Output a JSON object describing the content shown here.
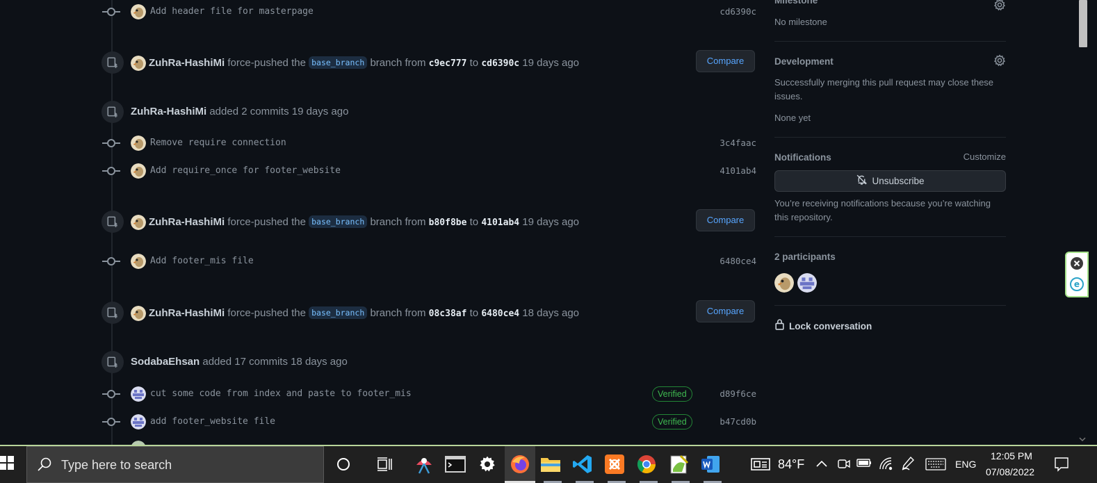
{
  "timeline": {
    "items": [
      {
        "kind": "commit",
        "message": "Add header file for masterpage",
        "sha": "cd6390c",
        "verified": false,
        "avatar": "bird"
      },
      {
        "kind": "force_push",
        "user": "ZuhRa-HashiMi",
        "action": "force-pushed the",
        "branch": "base_branch",
        "mid": "branch from",
        "from_sha": "c9ec777",
        "to": "to",
        "to_sha": "cd6390c",
        "time": "19 days ago",
        "compare": "Compare"
      },
      {
        "kind": "added",
        "user": "ZuhRa-HashiMi",
        "text": "added 2 commits 19 days ago"
      },
      {
        "kind": "commit",
        "message": "Remove require connection",
        "sha": "3c4faac",
        "avatar": "bird"
      },
      {
        "kind": "commit",
        "message": "Add require_once for footer_website",
        "sha": "4101ab4",
        "avatar": "bird"
      },
      {
        "kind": "force_push",
        "user": "ZuhRa-HashiMi",
        "action": "force-pushed the",
        "branch": "base_branch",
        "mid": "branch from",
        "from_sha": "b80f8be",
        "to": "to",
        "to_sha": "4101ab4",
        "time": "19 days ago",
        "compare": "Compare"
      },
      {
        "kind": "commit",
        "message": "Add footer_mis file",
        "sha": "6480ce4",
        "avatar": "bird"
      },
      {
        "kind": "force_push",
        "user": "ZuhRa-HashiMi",
        "action": "force-pushed the",
        "branch": "base_branch",
        "mid": "branch from",
        "from_sha": "08c38af",
        "to": "to",
        "to_sha": "6480ce4",
        "time": "18 days ago",
        "compare": "Compare"
      },
      {
        "kind": "added",
        "user": "SodabaEhsan",
        "text": "added 17 commits 18 days ago"
      },
      {
        "kind": "commit",
        "message": "cut some code from index and paste to footer_mis",
        "sha": "d89f6ce",
        "verified": "Verified",
        "avatar": "identicon"
      },
      {
        "kind": "commit",
        "message": "add footer_website file",
        "sha": "b47cd0b",
        "verified": "Verified",
        "avatar": "identicon"
      }
    ]
  },
  "sidebar": {
    "milestone": {
      "heading": "Milestone",
      "value": "No milestone"
    },
    "development": {
      "heading": "Development",
      "text": "Successfully merging this pull request may close these issues.",
      "value": "None yet"
    },
    "notifications": {
      "heading": "Notifications",
      "customize": "Customize",
      "button": "Unsubscribe",
      "text": "You’re receiving notifications because you’re watching this repository."
    },
    "participants": {
      "heading": "2 participants"
    },
    "lock": {
      "label": "Lock conversation"
    }
  },
  "taskbar": {
    "search_placeholder": "Type here to search",
    "weather": "84°F",
    "language": "ENG",
    "time": "12:05 PM",
    "date": "07/08/2022",
    "apps": [
      "cortana-icon",
      "task-view-icon",
      "snipping-tool-icon",
      "terminal-icon",
      "settings-icon",
      "firefox-icon",
      "file-explorer-icon",
      "vscode-icon",
      "xampp-icon",
      "chrome-icon",
      "notepad-plus-icon",
      "word-icon"
    ]
  },
  "colors": {
    "bg": "#0d1117",
    "link": "#58a6ff",
    "verified": "#3fb950",
    "text_muted": "#8b949e"
  }
}
